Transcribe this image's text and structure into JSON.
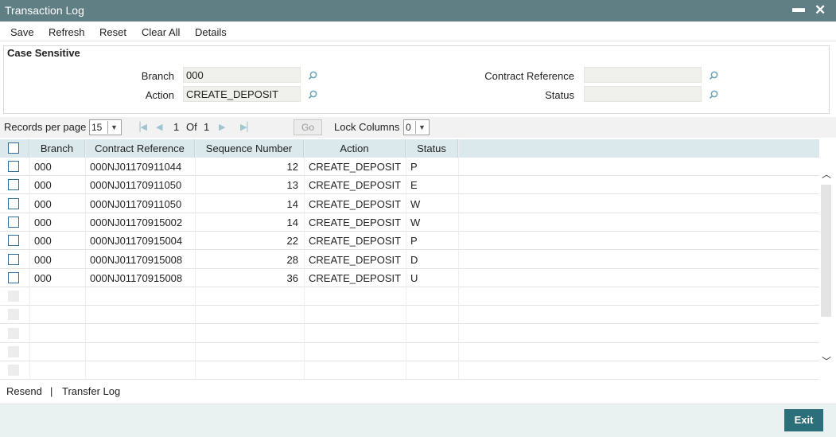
{
  "window": {
    "title": "Transaction Log",
    "minimize_glyph": "▬",
    "close_glyph": "✕"
  },
  "toolbar": {
    "save": "Save",
    "refresh": "Refresh",
    "reset": "Reset",
    "clear_all": "Clear All",
    "details": "Details"
  },
  "criteria": {
    "legend": "Case Sensitive",
    "branch_label": "Branch",
    "branch_value": "000",
    "action_label": "Action",
    "action_value": "CREATE_DEPOSIT",
    "contract_ref_label": "Contract Reference",
    "contract_ref_value": "",
    "status_label": "Status",
    "status_value": ""
  },
  "pager": {
    "records_label": "Records per page",
    "records_value": "15",
    "current_page": "1",
    "of_label": "Of",
    "total_pages": "1",
    "go_label": "Go",
    "lock_label": "Lock Columns",
    "lock_value": "0"
  },
  "grid": {
    "columns": [
      "Branch",
      "Contract Reference",
      "Sequence Number",
      "Action",
      "Status"
    ],
    "rows": [
      [
        "000",
        "000NJ01170911044",
        "12",
        "CREATE_DEPOSIT",
        "P"
      ],
      [
        "000",
        "000NJ01170911050",
        "13",
        "CREATE_DEPOSIT",
        "E"
      ],
      [
        "000",
        "000NJ01170911050",
        "14",
        "CREATE_DEPOSIT",
        "W"
      ],
      [
        "000",
        "000NJ01170915002",
        "14",
        "CREATE_DEPOSIT",
        "W"
      ],
      [
        "000",
        "000NJ01170915004",
        "22",
        "CREATE_DEPOSIT",
        "P"
      ],
      [
        "000",
        "000NJ01170915008",
        "28",
        "CREATE_DEPOSIT",
        "D"
      ],
      [
        "000",
        "000NJ01170915008",
        "36",
        "CREATE_DEPOSIT",
        "U"
      ]
    ]
  },
  "footer": {
    "resend": "Resend",
    "separator": "|",
    "transfer_log": "Transfer Log"
  },
  "bottom": {
    "exit": "Exit"
  },
  "colors": {
    "titlebar": "#5f7f85",
    "grid_header": "#dbe9ec",
    "exit_button": "#2a6f79",
    "checkbox_border": "#2f6e9a"
  }
}
